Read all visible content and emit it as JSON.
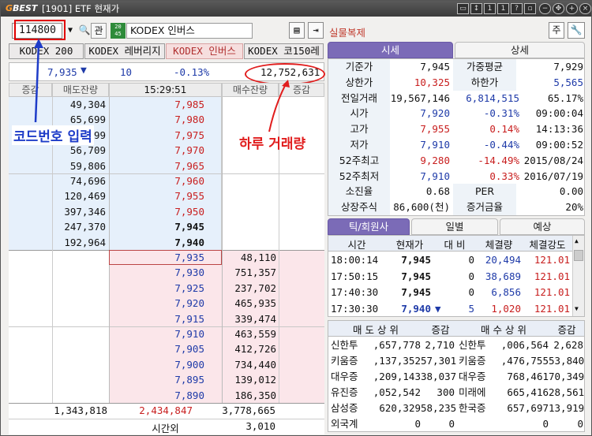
{
  "window": {
    "logo_a": "G",
    "logo_b": "BEST",
    "title": "[1901] ETF 현재가"
  },
  "toolbar": {
    "code": "114800",
    "search_label": "관",
    "green_icon_text": "20\n45",
    "name": "KODEX 인버스",
    "silmul_label": "실물복제",
    "ju_label": "주"
  },
  "etf_tabs": [
    "KODEX 200",
    "KODEX 레버리지",
    "KODEX 인버스",
    "KODEX 코150레"
  ],
  "summary": {
    "price": "7,935",
    "change": "10",
    "rate": "-0.13%",
    "volume": "12,752,631"
  },
  "hoga_header": {
    "c1": "증감",
    "c2": "매도잔량",
    "time": "15:29:51",
    "c4": "매수잔량",
    "c5": "증감"
  },
  "ask_rows": [
    {
      "qty": "49,304",
      "price": "7,985"
    },
    {
      "qty": "65,699",
      "price": "7,980"
    },
    {
      "qty": "96,199",
      "price": "7,975"
    },
    {
      "qty": "56,709",
      "price": "7,970"
    },
    {
      "qty": "59,806",
      "price": "7,965"
    },
    {
      "qty": "74,696",
      "price": "7,960"
    },
    {
      "qty": "120,469",
      "price": "7,955"
    },
    {
      "qty": "397,346",
      "price": "7,950"
    },
    {
      "qty": "247,370",
      "price": "7,945"
    },
    {
      "qty": "192,964",
      "price": "7,940"
    }
  ],
  "bid_rows": [
    {
      "price": "7,935",
      "qty": "48,110"
    },
    {
      "price": "7,930",
      "qty": "751,357"
    },
    {
      "price": "7,925",
      "qty": "237,702"
    },
    {
      "price": "7,920",
      "qty": "465,935"
    },
    {
      "price": "7,915",
      "qty": "339,474"
    },
    {
      "price": "7,910",
      "qty": "463,559"
    },
    {
      "price": "7,905",
      "qty": "412,726"
    },
    {
      "price": "7,900",
      "qty": "734,440"
    },
    {
      "price": "7,895",
      "qty": "139,012"
    },
    {
      "price": "7,890",
      "qty": "186,350"
    }
  ],
  "totals": {
    "ask": "1,343,818",
    "diff": "2,434,847",
    "bid": "3,778,665",
    "after_label": "시간외",
    "after_value": "3,010"
  },
  "panel_tabs": {
    "a": "시세",
    "b": "상세"
  },
  "info": [
    {
      "l1": "기준가",
      "v1": "7,945",
      "l2": "가중평균",
      "v2": "7,929"
    },
    {
      "l1": "상한가",
      "v1": "10,325",
      "l2": "하한가",
      "v2": "5,565"
    },
    {
      "l1": "전일거래",
      "v1": "19,567,146",
      "l2": "6,814,515",
      "v2": "65.17%"
    },
    {
      "l1": "시가",
      "v1": "7,920",
      "l2": "-0.31%",
      "v2": "09:00:04"
    },
    {
      "l1": "고가",
      "v1": "7,955",
      "l2": "0.14%",
      "v2": "14:13:36"
    },
    {
      "l1": "저가",
      "v1": "7,910",
      "l2": "-0.44%",
      "v2": "09:00:52"
    },
    {
      "l1": "52주최고",
      "v1": "9,280",
      "l2": "-14.49%",
      "v2": "2015/08/24"
    },
    {
      "l1": "52주최저",
      "v1": "7,910",
      "l2": "0.33%",
      "v2": "2016/07/19"
    },
    {
      "l1": "소진율",
      "v1": "0.68",
      "l2": "PER",
      "v2": "0.00"
    },
    {
      "l1": "상장주식",
      "v1": "86,600(천)",
      "l2": "증거금율",
      "v2": "20%"
    }
  ],
  "trade_tabs": {
    "a": "틱/회원사",
    "b": "일별",
    "c": "예상"
  },
  "trade_header": {
    "h1": "시간",
    "h2": "현재가",
    "h3": "대 비",
    "h4": "체결량",
    "h5": "체결강도"
  },
  "trades": [
    {
      "time": "18:00:14",
      "price": "7,945",
      "diff": "0",
      "qty": "20,494",
      "str": "121.01"
    },
    {
      "time": "17:50:15",
      "price": "7,945",
      "diff": "0",
      "qty": "38,689",
      "str": "121.01"
    },
    {
      "time": "17:40:30",
      "price": "7,945",
      "diff": "0",
      "qty": "6,856",
      "str": "121.01"
    },
    {
      "time": "17:30:30",
      "price": "7,940",
      "diff": "5",
      "qty": "1,020",
      "str": "121.01"
    }
  ],
  "broker_header": {
    "h1": "매 도 상 위",
    "h2": "증감",
    "h3": "매 수 상 위",
    "h4": "증감"
  },
  "brokers": [
    {
      "sn": "신한투",
      "sv": ",657,778",
      "sc": "2,710",
      "bn": "신한투",
      "bv": ",006,564",
      "bc": "2,628"
    },
    {
      "sn": "키움증",
      "sv": ",137,352",
      "sc": "57,301",
      "bn": "키움증",
      "bv": ",476,755",
      "bc": "53,840"
    },
    {
      "sn": "대우증",
      "sv": ",209,143",
      "sc": "38,037",
      "bn": "대우증",
      "bv": "768,461",
      "bc": "70,349"
    },
    {
      "sn": "유진증",
      "sv": ",052,542",
      "sc": "300",
      "bn": "미래에",
      "bv": "665,416",
      "bc": "28,561"
    },
    {
      "sn": "삼성증",
      "sv": "620,329",
      "sc": "58,235",
      "bn": "한국증",
      "bv": "657,697",
      "bc": "13,919"
    },
    {
      "sn": "외국계",
      "sv": "0",
      "sc": "0",
      "bn": "",
      "bv": "0",
      "bc": "0"
    }
  ],
  "annotations": {
    "code_input": "코드번호 입력",
    "daily_volume": "하루 거래량"
  },
  "colors": {
    "accent": "#7b6bb7",
    "up": "#c81e1e",
    "down": "#1e3aa8",
    "annot_red": "#e11d1d",
    "annot_blue": "#1e3cc8"
  }
}
